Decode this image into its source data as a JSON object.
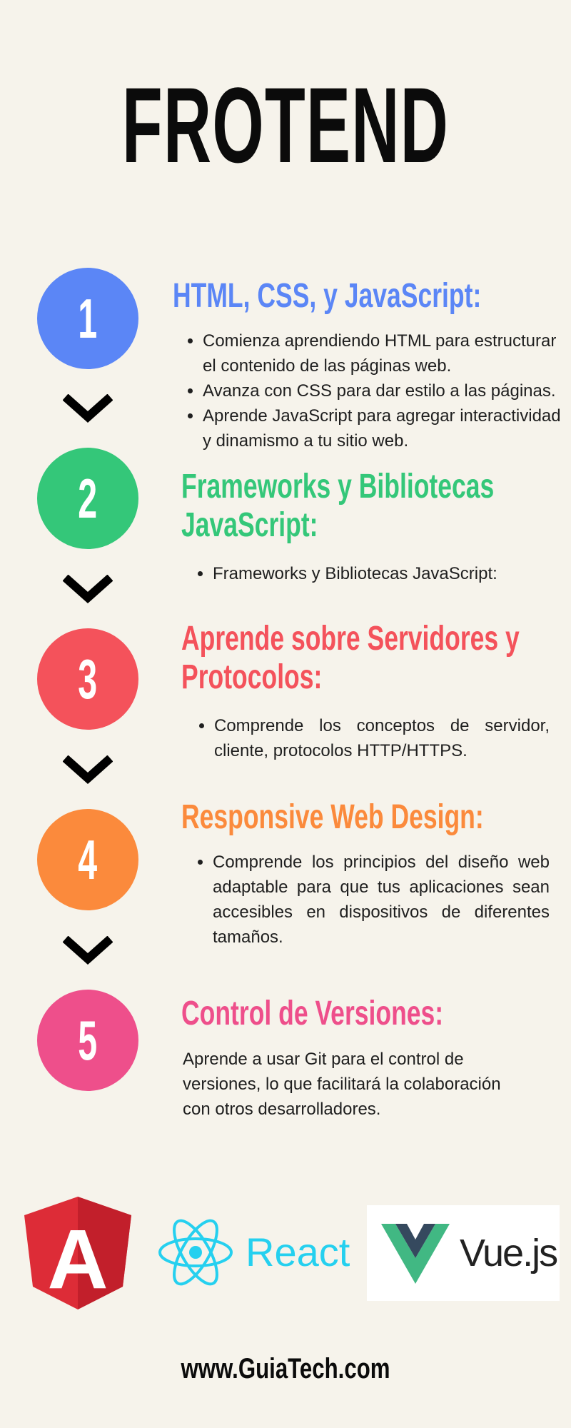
{
  "title": "FROTEND",
  "colors": {
    "background": "#f6f3eb",
    "step1": "#5b86f6",
    "step2": "#34c779",
    "step3": "#f4525b",
    "step4": "#fb8a3c",
    "step5": "#ee4f8b",
    "angular": "#dd2c37",
    "react": "#25d0ef",
    "vue_green": "#41b883",
    "vue_dark": "#35495e"
  },
  "steps": [
    {
      "number": "1",
      "heading": "HTML, CSS, y JavaScript:",
      "bullets": [
        "Comienza aprendiendo HTML para estructurar el contenido de las páginas web.",
        "Avanza con CSS para dar estilo a las páginas.",
        "Aprende JavaScript para agregar interactividad y dinamismo a tu sitio web."
      ]
    },
    {
      "number": "2",
      "heading_line1": "Frameworks y Bibliotecas",
      "heading_line2": "JavaScript:",
      "bullets": [
        "Frameworks y Bibliotecas JavaScript:"
      ]
    },
    {
      "number": "3",
      "heading_line1": "Aprende sobre Servidores y",
      "heading_line2": "Protocolos:",
      "bullets": [
        "Comprende los conceptos de servidor, cliente, protocolos HTTP/HTTPS."
      ]
    },
    {
      "number": "4",
      "heading": "Responsive Web Design:",
      "bullets": [
        "Comprende los principios del diseño web adaptable para que tus aplicaciones sean accesibles en dispositivos de diferentes tamaños."
      ]
    },
    {
      "number": "5",
      "heading": "Control de Versiones:",
      "paragraph": "Aprende a usar Git para el control de versiones, lo que facilitará la colaboración con otros desarrolladores."
    }
  ],
  "logos": {
    "angular_letter": "A",
    "react_label": "React",
    "vue_label": "Vue.js"
  },
  "footer": "www.GuiaTech.com"
}
